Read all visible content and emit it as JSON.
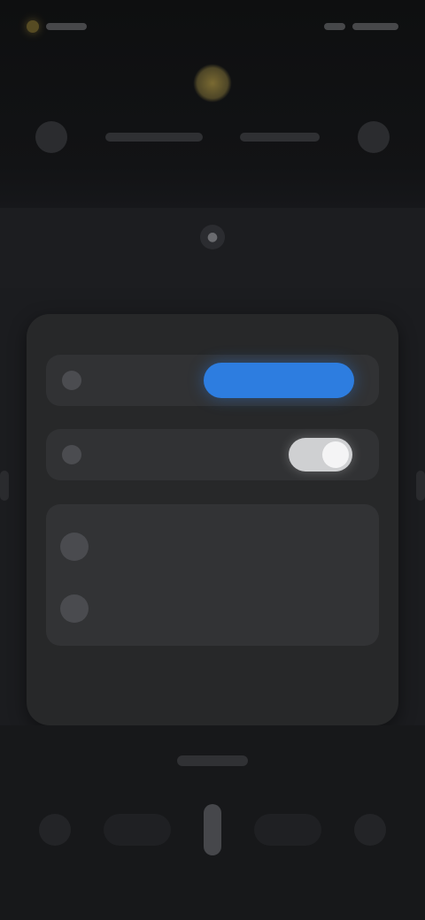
{
  "status": {
    "left_icon": "sun-status-icon",
    "right_icon": "battery-icon"
  },
  "hero": {
    "weather_icon": "sun-icon"
  },
  "weather": {
    "left_icon": "cloud-icon",
    "right_icon": "moon-icon"
  },
  "lock": {
    "icon": "lock-icon",
    "glyph": "●"
  },
  "card": {
    "rows": [
      {
        "icon": "wifi-icon",
        "label": "",
        "button_label": ""
      },
      {
        "icon": "bluetooth-icon",
        "label": ""
      }
    ],
    "list": [
      {
        "icon": "user-icon",
        "title": "",
        "subtitle": ""
      },
      {
        "icon": "device-icon",
        "title": "",
        "subtitle": ""
      }
    ]
  },
  "bottom": {
    "title": "",
    "nav": {
      "left_icon": "back-icon",
      "right_icon": "home-icon"
    }
  },
  "colors": {
    "accent": "#2d7de0",
    "background": "#1b1c1f",
    "card": "#272829"
  }
}
